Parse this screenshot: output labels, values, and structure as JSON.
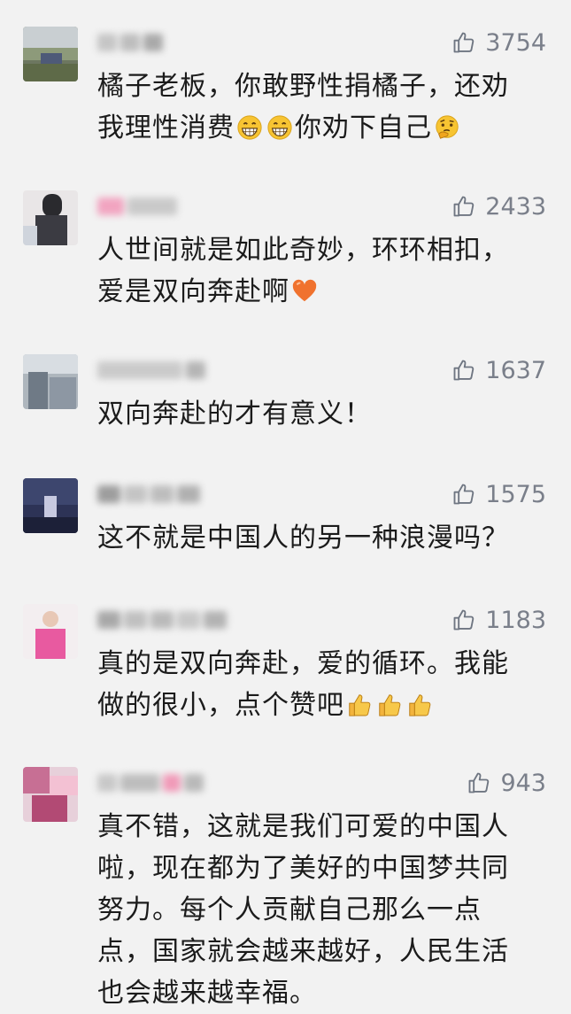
{
  "colors": {
    "background": "#f2f2f2",
    "text": "#1b1b1b",
    "meta": "#7a7f8a"
  },
  "comments": [
    {
      "name": "",
      "likes": "3754",
      "lines": [
        "橘子老板，你敢野性捐橘子，还劝",
        "我理性消费",
        "你劝下自己"
      ],
      "emojis": [
        "grinning-face-icon",
        "grinning-face-icon",
        "thinking-face-icon"
      ]
    },
    {
      "name": "",
      "likes": "2433",
      "lines": [
        "人世间就是如此奇妙，环环相扣，",
        "爱是双向奔赴啊"
      ],
      "emojis": [
        "orange-heart-icon"
      ]
    },
    {
      "name": "",
      "likes": "1637",
      "lines": [
        "双向奔赴的才有意义！"
      ]
    },
    {
      "name": "",
      "likes": "1575",
      "lines": [
        "这不就是中国人的另一种浪漫吗？"
      ]
    },
    {
      "name": "",
      "likes": "1183",
      "lines": [
        "真的是双向奔赴，爱的循环。我能",
        "做的很小，点个赞吧"
      ],
      "emojis": [
        "thumbs-up-icon",
        "thumbs-up-icon",
        "thumbs-up-icon"
      ]
    },
    {
      "name": "",
      "likes": "943",
      "lines": [
        "真不错，这就是我们可爱的中国人",
        "啦，现在都为了美好的中国梦共同",
        "努力。每个人贡献自己那么一点",
        "点，国家就会越来越好，人民生活",
        "也会越来越幸福。"
      ]
    }
  ]
}
